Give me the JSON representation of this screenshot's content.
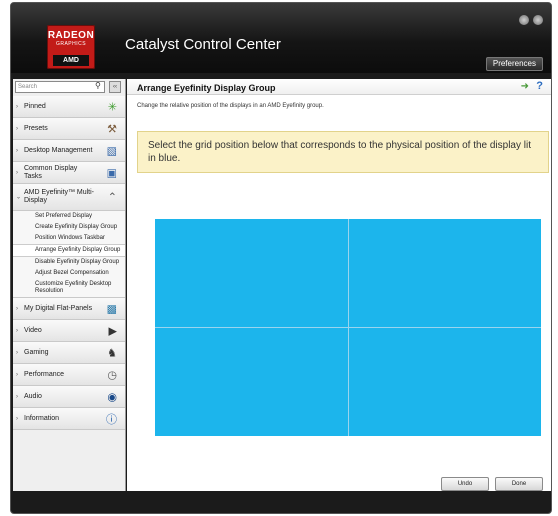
{
  "app": {
    "title": "Catalyst Control Center",
    "logo_brand": "RADEON",
    "logo_sub": "GRAPHICS",
    "logo_vendor": "AMD",
    "preferences": "Preferences"
  },
  "sidebar": {
    "search_placeholder": "Search",
    "items": [
      {
        "label": "Pinned",
        "icon": "pin-icon"
      },
      {
        "label": "Presets",
        "icon": "presets-icon"
      },
      {
        "label": "Desktop Management",
        "icon": "desktop-icon"
      },
      {
        "label": "Common Display Tasks",
        "icon": "display-tasks-icon"
      },
      {
        "label": "AMD Eyefinity™ Multi-Display",
        "icon": "eyefinity-icon",
        "expanded": true
      },
      {
        "label": "My Digital Flat-Panels",
        "icon": "monitor-icon"
      },
      {
        "label": "Video",
        "icon": "video-icon"
      },
      {
        "label": "Gaming",
        "icon": "gaming-icon"
      },
      {
        "label": "Performance",
        "icon": "performance-icon"
      },
      {
        "label": "Audio",
        "icon": "audio-icon"
      },
      {
        "label": "Information",
        "icon": "info-icon"
      }
    ],
    "eyefinity_sub": [
      "Set Preferred Display",
      "Create Eyefinity Display Group",
      "Position Windows Taskbar",
      "Arrange Eyefinity Display Group",
      "Disable Eyefinity Display Group",
      "Adjust Bezel Compensation",
      "Customize Eyefinity Desktop Resolution"
    ],
    "active_sub": "Arrange Eyefinity Display Group"
  },
  "main": {
    "title": "Arrange Eyefinity Display Group",
    "description": "Change the relative position of the displays in an AMD Eyefinity group.",
    "tip": "Select the grid position below that corresponds to the physical position of the display lit in blue.",
    "help": "?",
    "grid_color": "#1cb5ec"
  },
  "footer": {
    "undo": "Undo",
    "done": "Done"
  }
}
